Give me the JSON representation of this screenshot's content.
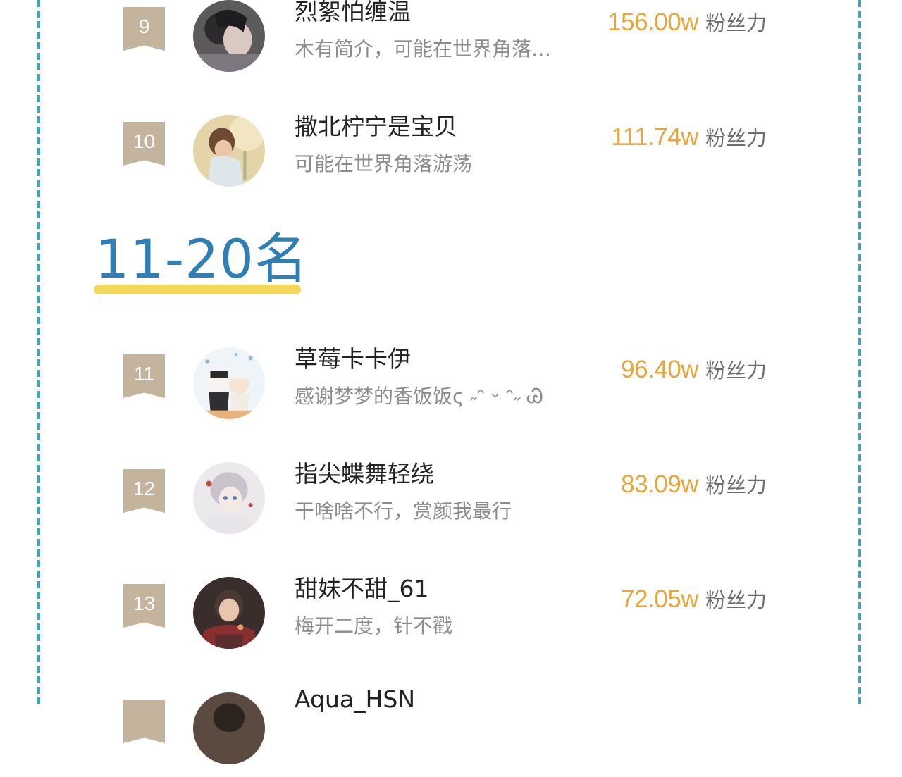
{
  "section": {
    "title": "11-20名"
  },
  "colors": {
    "border": "#4b9fb0",
    "badge": "#c4b49e",
    "fans": "#e7a63a",
    "title": "#2f7fb5",
    "underline": "#f3d75a"
  },
  "rankings": [
    {
      "rank": "9",
      "name": "烈絮怕缠温",
      "bio": "木有简介，可能在世界角落…",
      "fans_value": "156.00w",
      "fans_label": "粉丝力"
    },
    {
      "rank": "10",
      "name": "撒北柠宁是宝贝",
      "bio": "可能在世界角落游荡",
      "fans_value": "111.74w",
      "fans_label": "粉丝力"
    },
    {
      "rank": "11",
      "name": "草莓卡卡伊",
      "bio": "感谢梦梦的香饭饭ς ˶ᵔ ᵕ ᵔ˶ Ꮚ",
      "fans_value": "96.40w",
      "fans_label": "粉丝力"
    },
    {
      "rank": "12",
      "name": "指尖蝶舞轻绕",
      "bio": "干啥啥不行，赏颜我最行",
      "fans_value": "83.09w",
      "fans_label": "粉丝力"
    },
    {
      "rank": "13",
      "name": "甜妹不甜_61",
      "bio": "梅开二度，针不戳",
      "fans_value": "72.05w",
      "fans_label": "粉丝力"
    },
    {
      "rank": "",
      "name": "Aqua_HSN",
      "bio": "",
      "fans_value": "",
      "fans_label": ""
    }
  ]
}
